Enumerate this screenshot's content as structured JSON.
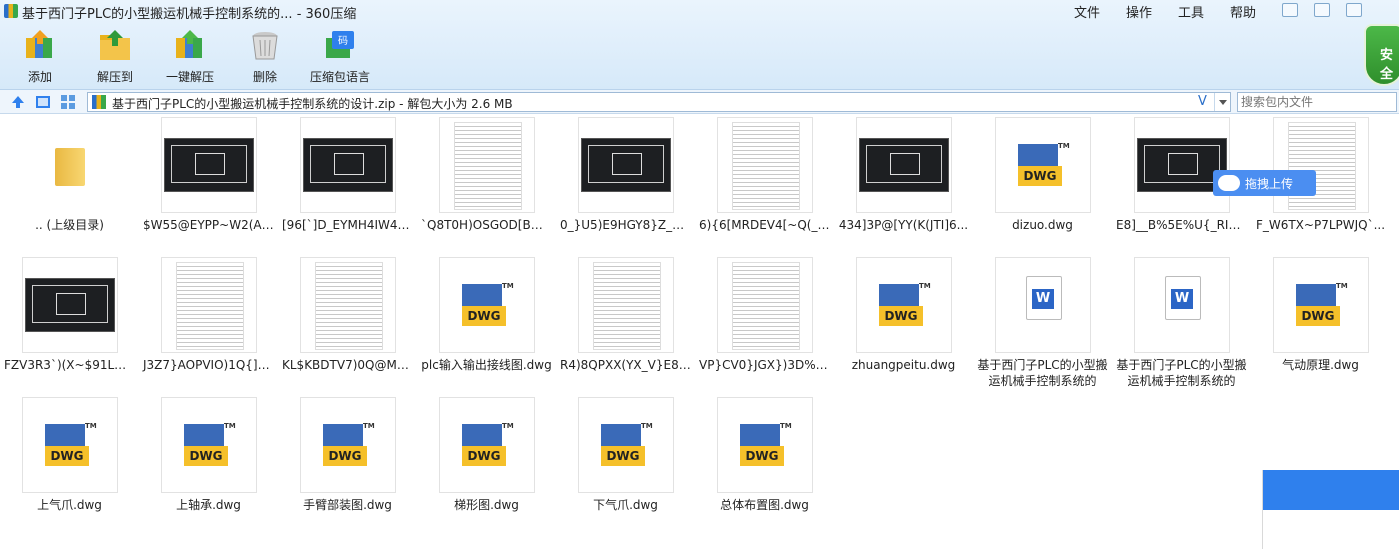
{
  "window": {
    "title": "基于西门子PLC的小型搬运机械手控制系统的... - 360压缩",
    "menus": [
      "文件",
      "操作",
      "工具",
      "帮助"
    ]
  },
  "toolbar": {
    "add": "添加",
    "extract_to": "解压到",
    "one_click_extract": "一键解压",
    "delete": "删除",
    "archive_language": "压缩包语言"
  },
  "security_badge": "安全",
  "address": {
    "path": "基于西门子PLC的小型搬运机械手控制系统的设计.zip - 解包大小为 2.6 MB",
    "search_placeholder": "搜索包内文件"
  },
  "upload_button": "拖拽上传",
  "files": [
    {
      "name": ".. (上级目录)",
      "kind": "folder"
    },
    {
      "name": "$W55@EYPP~W2(A(...",
      "kind": "cad"
    },
    {
      "name": "[96[`]D_EYMH4IW4A{...",
      "kind": "cad"
    },
    {
      "name": "`Q8T0H)OSGOD[B%}...",
      "kind": "doc"
    },
    {
      "name": "0_}U5)E9HGY8}Z_Y10...",
      "kind": "cad"
    },
    {
      "name": "6){6[MRDEV4[~Q(_(...",
      "kind": "doc"
    },
    {
      "name": "434]3P@[YY(K(JTI]6...",
      "kind": "cad"
    },
    {
      "name": "dizuo.dwg",
      "kind": "dwg"
    },
    {
      "name": "E8]__B%5E%U{_RI4TB...",
      "kind": "cad"
    },
    {
      "name": "F_W6TX~P7LPWJQ`...",
      "kind": "doc"
    },
    {
      "name": "FZV3R3`)(X~$91LH7B...",
      "kind": "cad"
    },
    {
      "name": "J3Z7}AOPVIO)1Q{]KT...",
      "kind": "doc"
    },
    {
      "name": "KL$KBDTV7)0Q@M5...",
      "kind": "doc"
    },
    {
      "name": "plc输入输出接线图.dwg",
      "kind": "dwg"
    },
    {
      "name": "R4)8QPXX(YX_V}E8X...",
      "kind": "doc"
    },
    {
      "name": "VP}CV0}JGX})3D%T8...",
      "kind": "doc"
    },
    {
      "name": "zhuangpeitu.dwg",
      "kind": "dwg"
    },
    {
      "name": "基于西门子PLC的小型搬运机械手控制系统的设...",
      "kind": "word"
    },
    {
      "name": "基于西门子PLC的小型搬运机械手控制系统的设...",
      "kind": "word"
    },
    {
      "name": "气动原理.dwg",
      "kind": "dwg"
    },
    {
      "name": "上气爪.dwg",
      "kind": "dwg"
    },
    {
      "name": "上轴承.dwg",
      "kind": "dwg"
    },
    {
      "name": "手臂部装图.dwg",
      "kind": "dwg"
    },
    {
      "name": "梯形图.dwg",
      "kind": "dwg"
    },
    {
      "name": "下气爪.dwg",
      "kind": "dwg"
    },
    {
      "name": "总体布置图.dwg",
      "kind": "dwg"
    }
  ],
  "colors": {
    "accent": "#2f80ed",
    "dwg_blue": "#3a6ab8",
    "dwg_yellow": "#f5c02a",
    "shield_green": "#4cb848"
  }
}
